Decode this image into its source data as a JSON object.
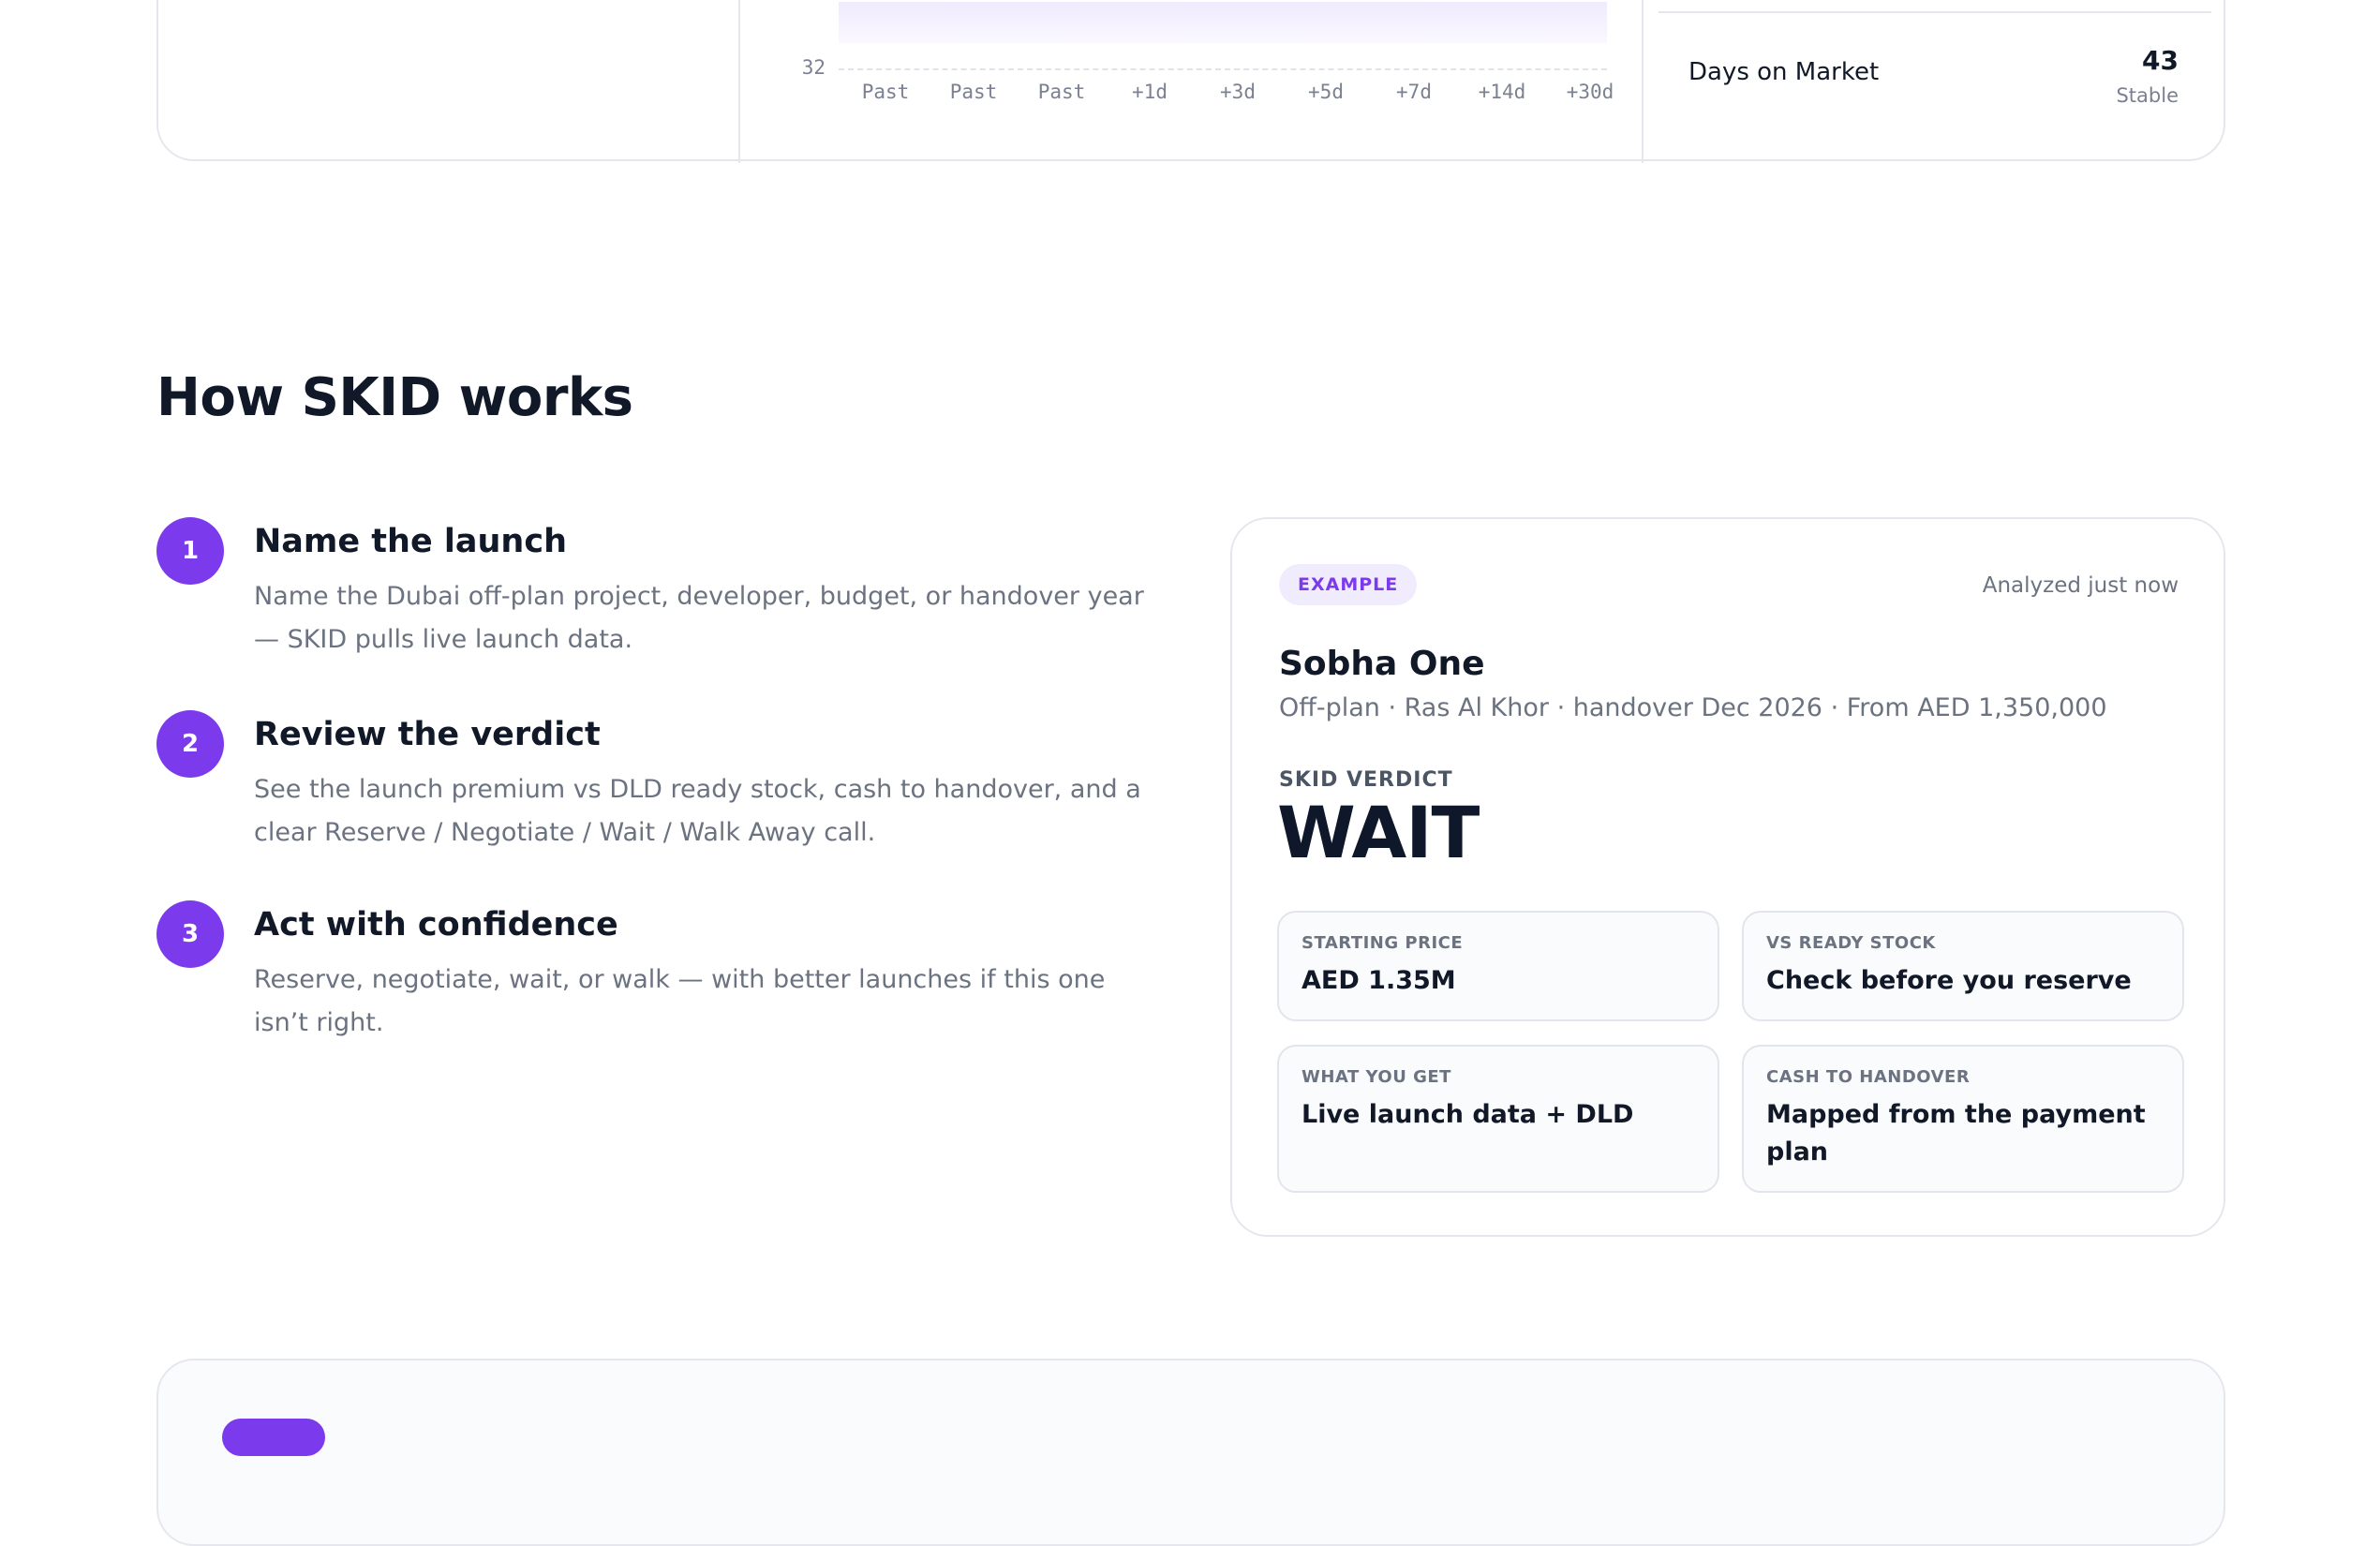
{
  "top_card": {
    "chart": {
      "y_tick": "32",
      "x_ticks": [
        "Past",
        "Past",
        "Past",
        "+1d",
        "+3d",
        "+5d",
        "+7d",
        "+14d",
        "+30d"
      ]
    },
    "stat": {
      "label": "Days on Market",
      "value": "43",
      "trend": "Stable"
    }
  },
  "how_it_works": {
    "title": "How SKID works",
    "steps": [
      {
        "number": "1",
        "title": "Name the launch",
        "description": "Name the Dubai off-plan project, developer, budget, or handover year — SKID pulls live launch data."
      },
      {
        "number": "2",
        "title": "Review the verdict",
        "description": "See the launch premium vs DLD ready stock, cash to handover, and a clear Reserve / Negotiate / Wait / Walk Away call."
      },
      {
        "number": "3",
        "title": "Act with confidence",
        "description": "Reserve, negotiate, wait, or walk — with better launches if this one isn’t right."
      }
    ]
  },
  "example": {
    "badge": "EXAMPLE",
    "analyzed": "Analyzed just now",
    "project_name": "Sobha One",
    "project_meta": "Off-plan · Ras Al Khor · handover Dec 2026 · From AED 1,350,000",
    "verdict_label": "SKID VERDICT",
    "verdict": "WAIT",
    "tiles": [
      {
        "label": "STARTING PRICE",
        "value": "AED 1.35M"
      },
      {
        "label": "VS READY STOCK",
        "value": "Check before you reserve"
      },
      {
        "label": "WHAT YOU GET",
        "value": "Live launch data + DLD"
      },
      {
        "label": "CASH TO HANDOVER",
        "value": "Mapped from the payment plan"
      }
    ]
  },
  "colors": {
    "accent": "#7c3aed",
    "text": "#111827",
    "muted": "#6b7280",
    "border": "#e6e7ee"
  }
}
